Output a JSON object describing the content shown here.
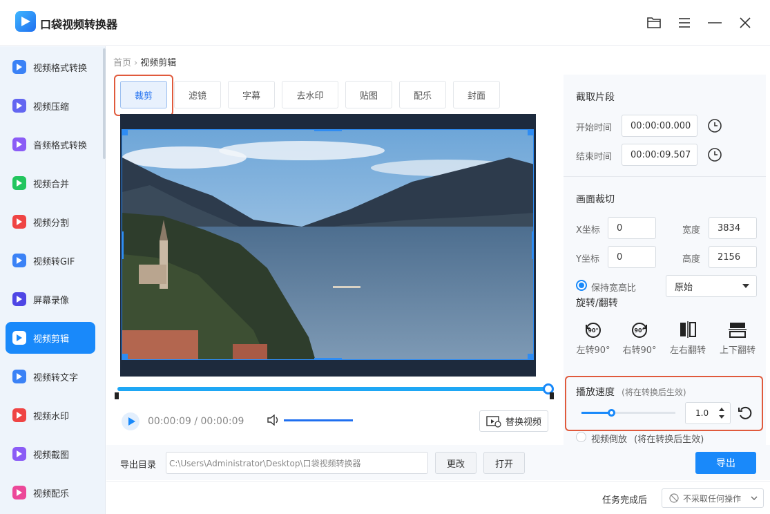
{
  "app": {
    "title": "口袋视频转换器"
  },
  "window": {
    "folder_icon": "folder-icon",
    "menu_icon": "menu-icon",
    "minimize_icon": "minimize-icon",
    "close_icon": "close-icon"
  },
  "sidebar": {
    "items": [
      {
        "label": "视频格式转换",
        "color": "#3b82f6"
      },
      {
        "label": "视频压缩",
        "color": "#6366f1"
      },
      {
        "label": "音频格式转换",
        "color": "#8b5cf6"
      },
      {
        "label": "视频合并",
        "color": "#22c55e"
      },
      {
        "label": "视频分割",
        "color": "#ef4444"
      },
      {
        "label": "视频转GIF",
        "color": "#3b82f6"
      },
      {
        "label": "屏幕录像",
        "color": "#4f46e5"
      },
      {
        "label": "视频剪辑",
        "color": "#1989fa"
      },
      {
        "label": "视频转文字",
        "color": "#3b82f6"
      },
      {
        "label": "视频水印",
        "color": "#ef4444"
      },
      {
        "label": "视频截图",
        "color": "#8b5cf6"
      },
      {
        "label": "视频配乐",
        "color": "#ec4899"
      }
    ],
    "active_index": 7
  },
  "breadcrumb": {
    "home": "首页",
    "separator": "›",
    "current": "视频剪辑"
  },
  "tabs": [
    "裁剪",
    "滤镜",
    "字幕",
    "去水印",
    "贴图",
    "配乐",
    "封面"
  ],
  "player": {
    "current_time": "00:00:09",
    "total_time": "00:00:09",
    "time_separator": "/",
    "replace_label": "替换视频",
    "progress": 1.0,
    "volume": 1.0
  },
  "trim": {
    "title": "截取片段",
    "start_label": "开始时间",
    "start_value": "00:00:00.000",
    "end_label": "结束时间",
    "end_value": "00:00:09.507"
  },
  "crop": {
    "title": "画面裁切",
    "x_label": "X坐标",
    "x_value": "0",
    "y_label": "Y坐标",
    "y_value": "0",
    "w_label": "宽度",
    "w_value": "3834",
    "h_label": "高度",
    "h_value": "2156",
    "keep_ratio_label": "保持宽高比",
    "ratio_value": "原始"
  },
  "rotate": {
    "title": "旋转/翻转",
    "left90": "左转90°",
    "right90": "右转90°",
    "flip_h": "左右翻转",
    "flip_v": "上下翻转",
    "badge": "90°"
  },
  "speed": {
    "title": "播放速度",
    "hint": "(将在转换后生效)",
    "value": "1.0",
    "slider_fraction": 0.32
  },
  "reverse": {
    "label": "视频倒放",
    "hint": "(将在转换后生效)"
  },
  "export": {
    "label": "导出目录",
    "path": "C:\\Users\\Administrator\\Desktop\\口袋视频转换器",
    "change": "更改",
    "open": "打开",
    "export": "导出"
  },
  "status": {
    "after_label": "任务完成后",
    "after_value": "不采取任何操作"
  }
}
